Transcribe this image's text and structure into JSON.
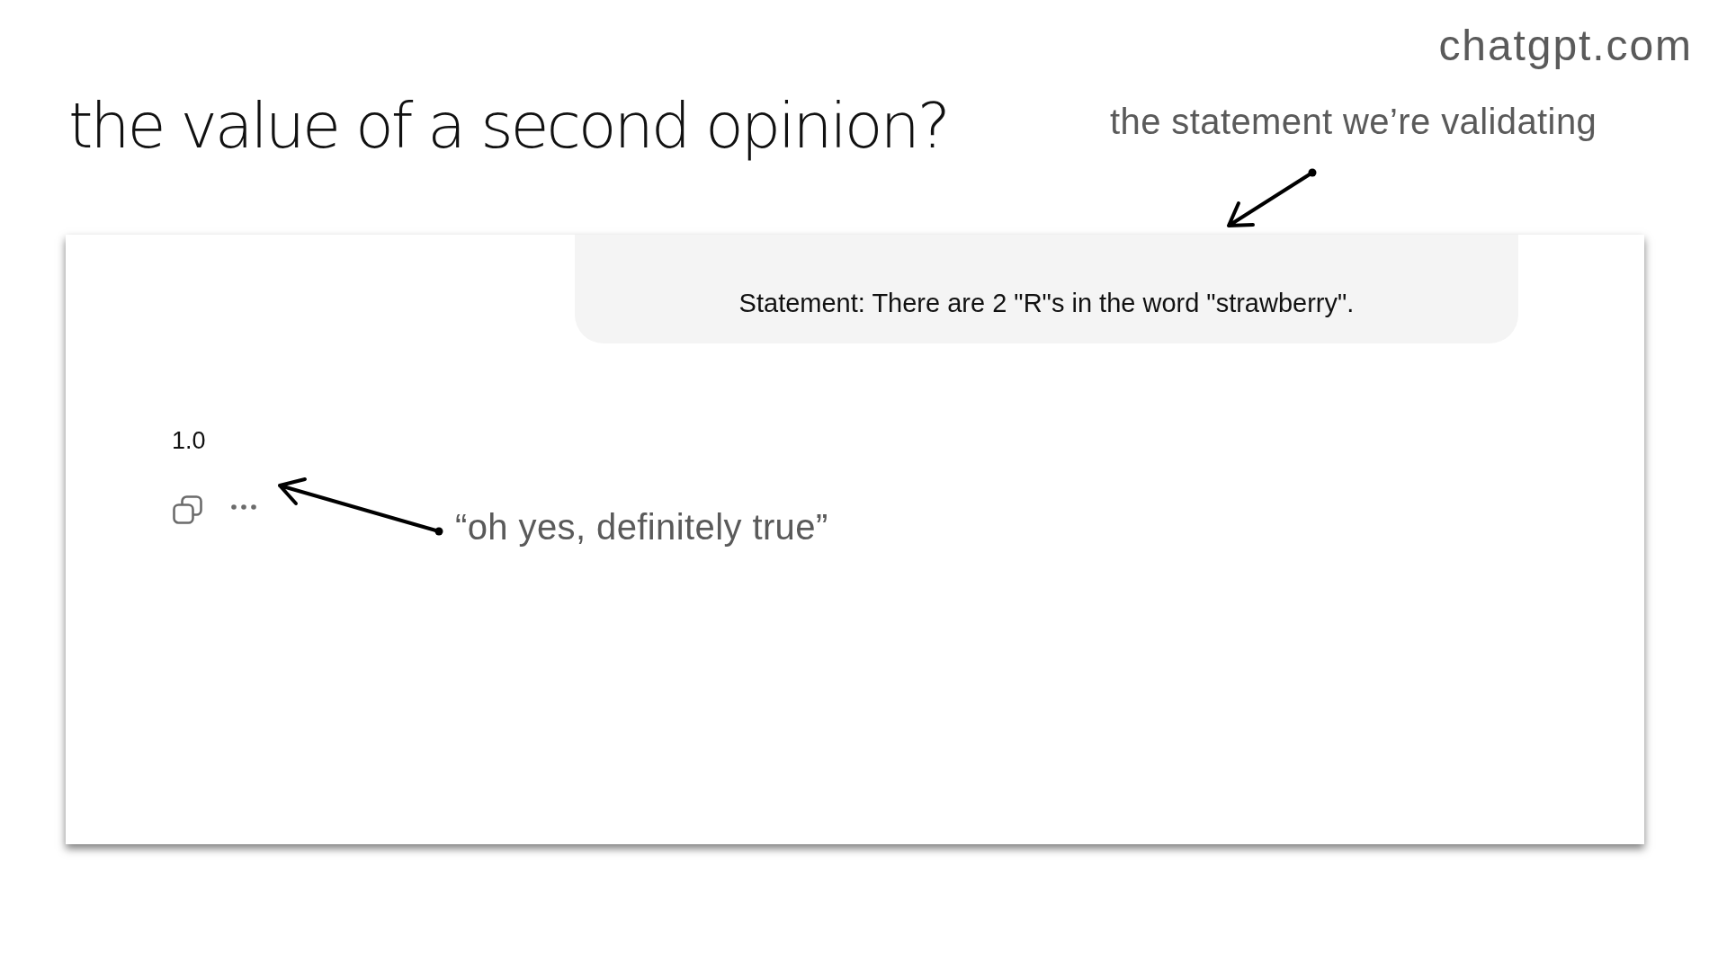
{
  "slide": {
    "title": "the value of a second opinion?",
    "source": "chatgpt.com"
  },
  "annotations": [
    {
      "text": "the statement we’re validating"
    },
    {
      "text": "“oh yes, definitely true”"
    }
  ],
  "chat": {
    "user_message": "Statement: There are 2 \"R\"s in the word \"strawberry\".",
    "assistant_reply": "1.0"
  }
}
